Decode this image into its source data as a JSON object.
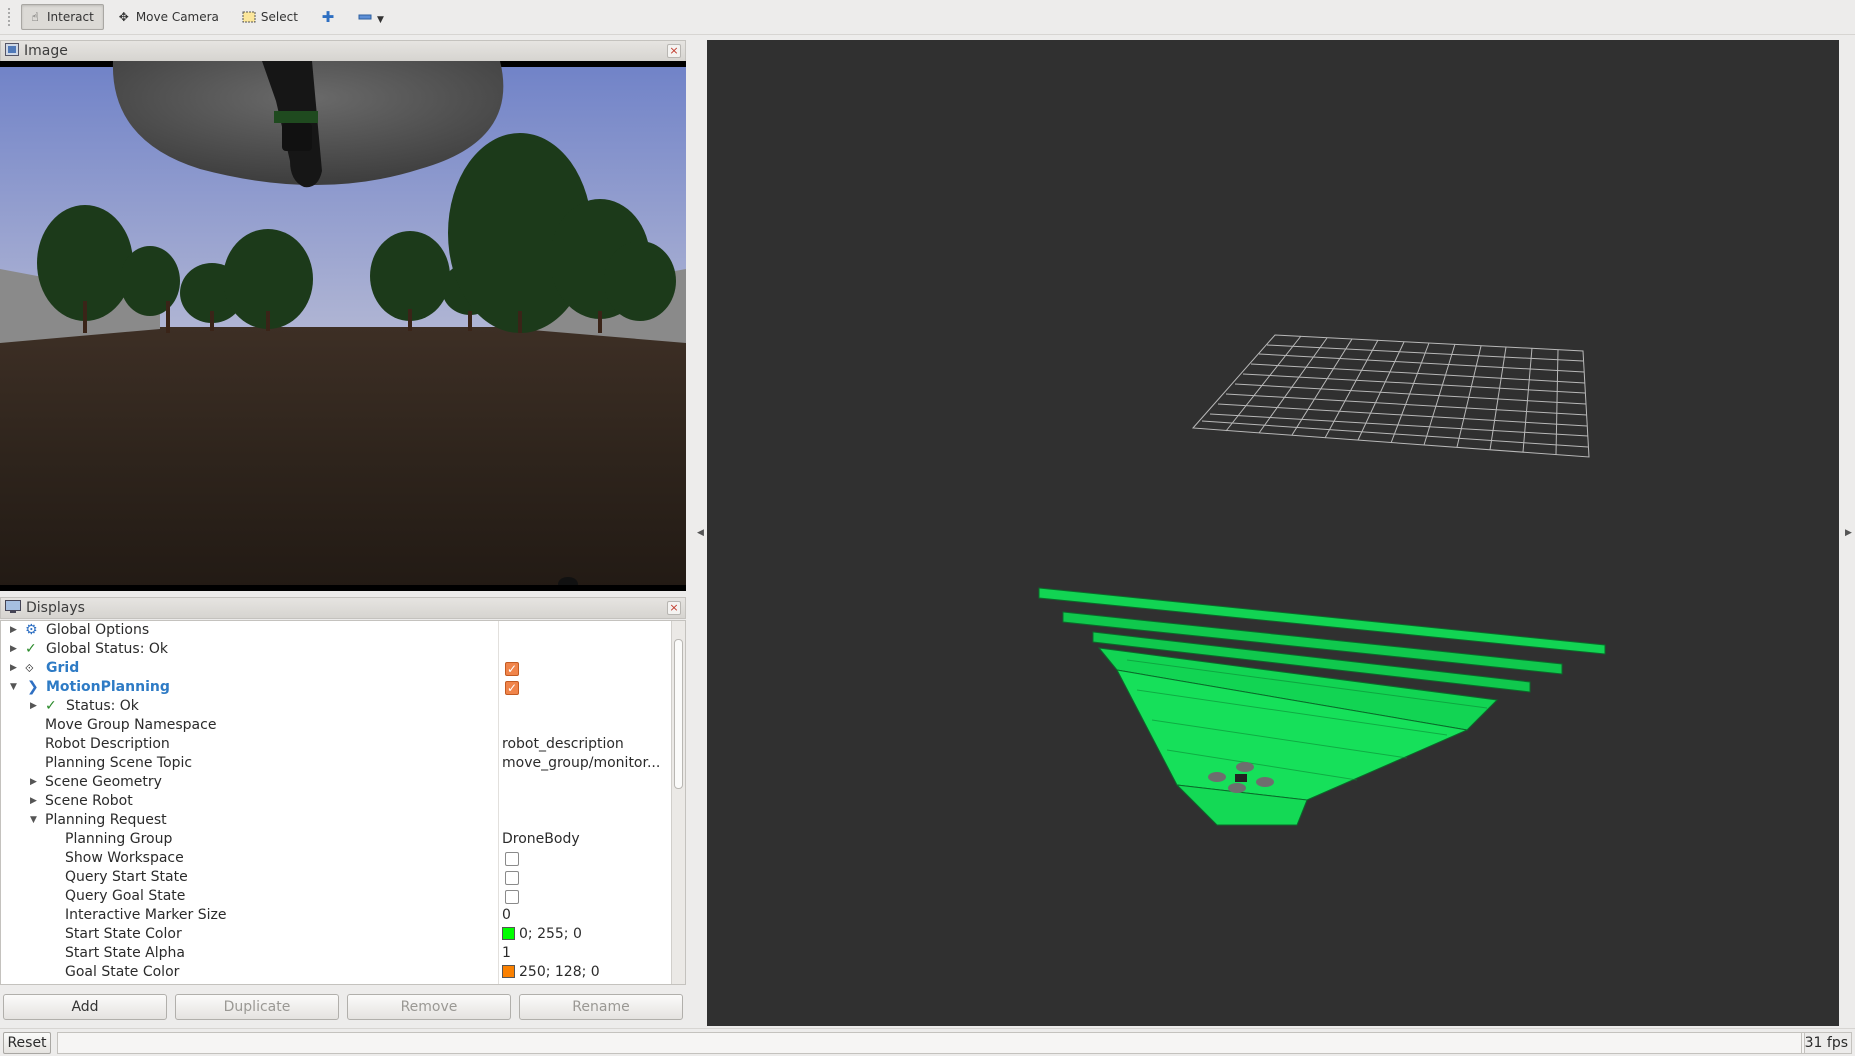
{
  "toolbar": {
    "interact": "Interact",
    "move_camera": "Move Camera",
    "select": "Select"
  },
  "image_panel": {
    "title": "Image"
  },
  "displays_panel": {
    "title": "Displays",
    "rows": {
      "global_options": "Global Options",
      "global_status": "Global Status: Ok",
      "grid": "Grid",
      "motion_planning": "MotionPlanning",
      "status": "Status: Ok",
      "move_group_namespace": "Move Group Namespace",
      "robot_description": "Robot Description",
      "robot_description_val": "robot_description",
      "planning_scene_topic": "Planning Scene Topic",
      "planning_scene_topic_val": "move_group/monitor...",
      "scene_geometry": "Scene Geometry",
      "scene_robot": "Scene Robot",
      "planning_request": "Planning Request",
      "planning_group": "Planning Group",
      "planning_group_val": "DroneBody",
      "show_workspace": "Show Workspace",
      "query_start_state": "Query Start State",
      "query_goal_state": "Query Goal State",
      "interactive_marker_size": "Interactive Marker Size",
      "interactive_marker_size_val": "0",
      "start_state_color": "Start State Color",
      "start_state_color_val": "0; 255; 0",
      "start_state_alpha": "Start State Alpha",
      "start_state_alpha_val": "1",
      "goal_state_color": "Goal State Color",
      "goal_state_color_val": "250; 128; 0"
    },
    "colors": {
      "start": "#00ff00",
      "goal": "#fa8000"
    }
  },
  "buttons": {
    "add": "Add",
    "duplicate": "Duplicate",
    "remove": "Remove",
    "rename": "Rename"
  },
  "status_bar": {
    "reset": "Reset",
    "fps": "31 fps"
  }
}
